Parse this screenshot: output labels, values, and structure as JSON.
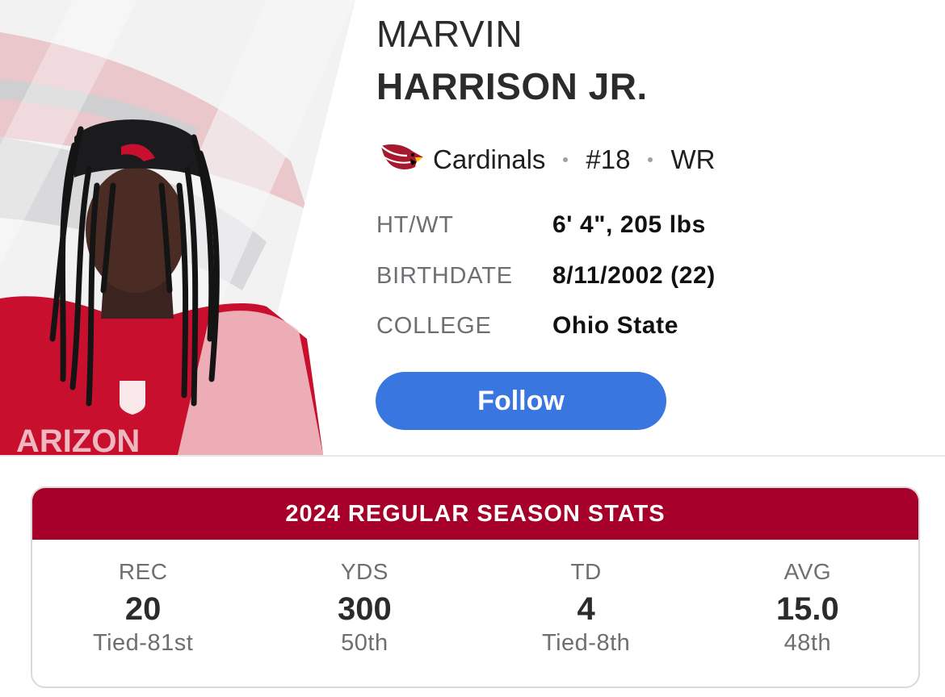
{
  "player": {
    "first_name": "MARVIN",
    "last_name": "HARRISON JR.",
    "team": "Cardinals",
    "number": "#18",
    "position": "WR"
  },
  "bio": [
    {
      "label": "HT/WT",
      "value": "6' 4\", 205 lbs"
    },
    {
      "label": "BIRTHDATE",
      "value": "8/11/2002 (22)"
    },
    {
      "label": "COLLEGE",
      "value": "Ohio State"
    }
  ],
  "follow_label": "Follow",
  "stats": {
    "title": "2024 REGULAR SEASON STATS",
    "columns": [
      {
        "label": "REC",
        "value": "20",
        "rank": "Tied-81st"
      },
      {
        "label": "YDS",
        "value": "300",
        "rank": "50th"
      },
      {
        "label": "TD",
        "value": "4",
        "rank": "Tied-8th"
      },
      {
        "label": "AVG",
        "value": "15.0",
        "rank": "48th"
      }
    ]
  },
  "colors": {
    "accent_blue": "#3a76e0",
    "cardinals_red": "#a6002a",
    "team_logo": "cardinals-logo-icon",
    "photo": "player-headshot"
  }
}
